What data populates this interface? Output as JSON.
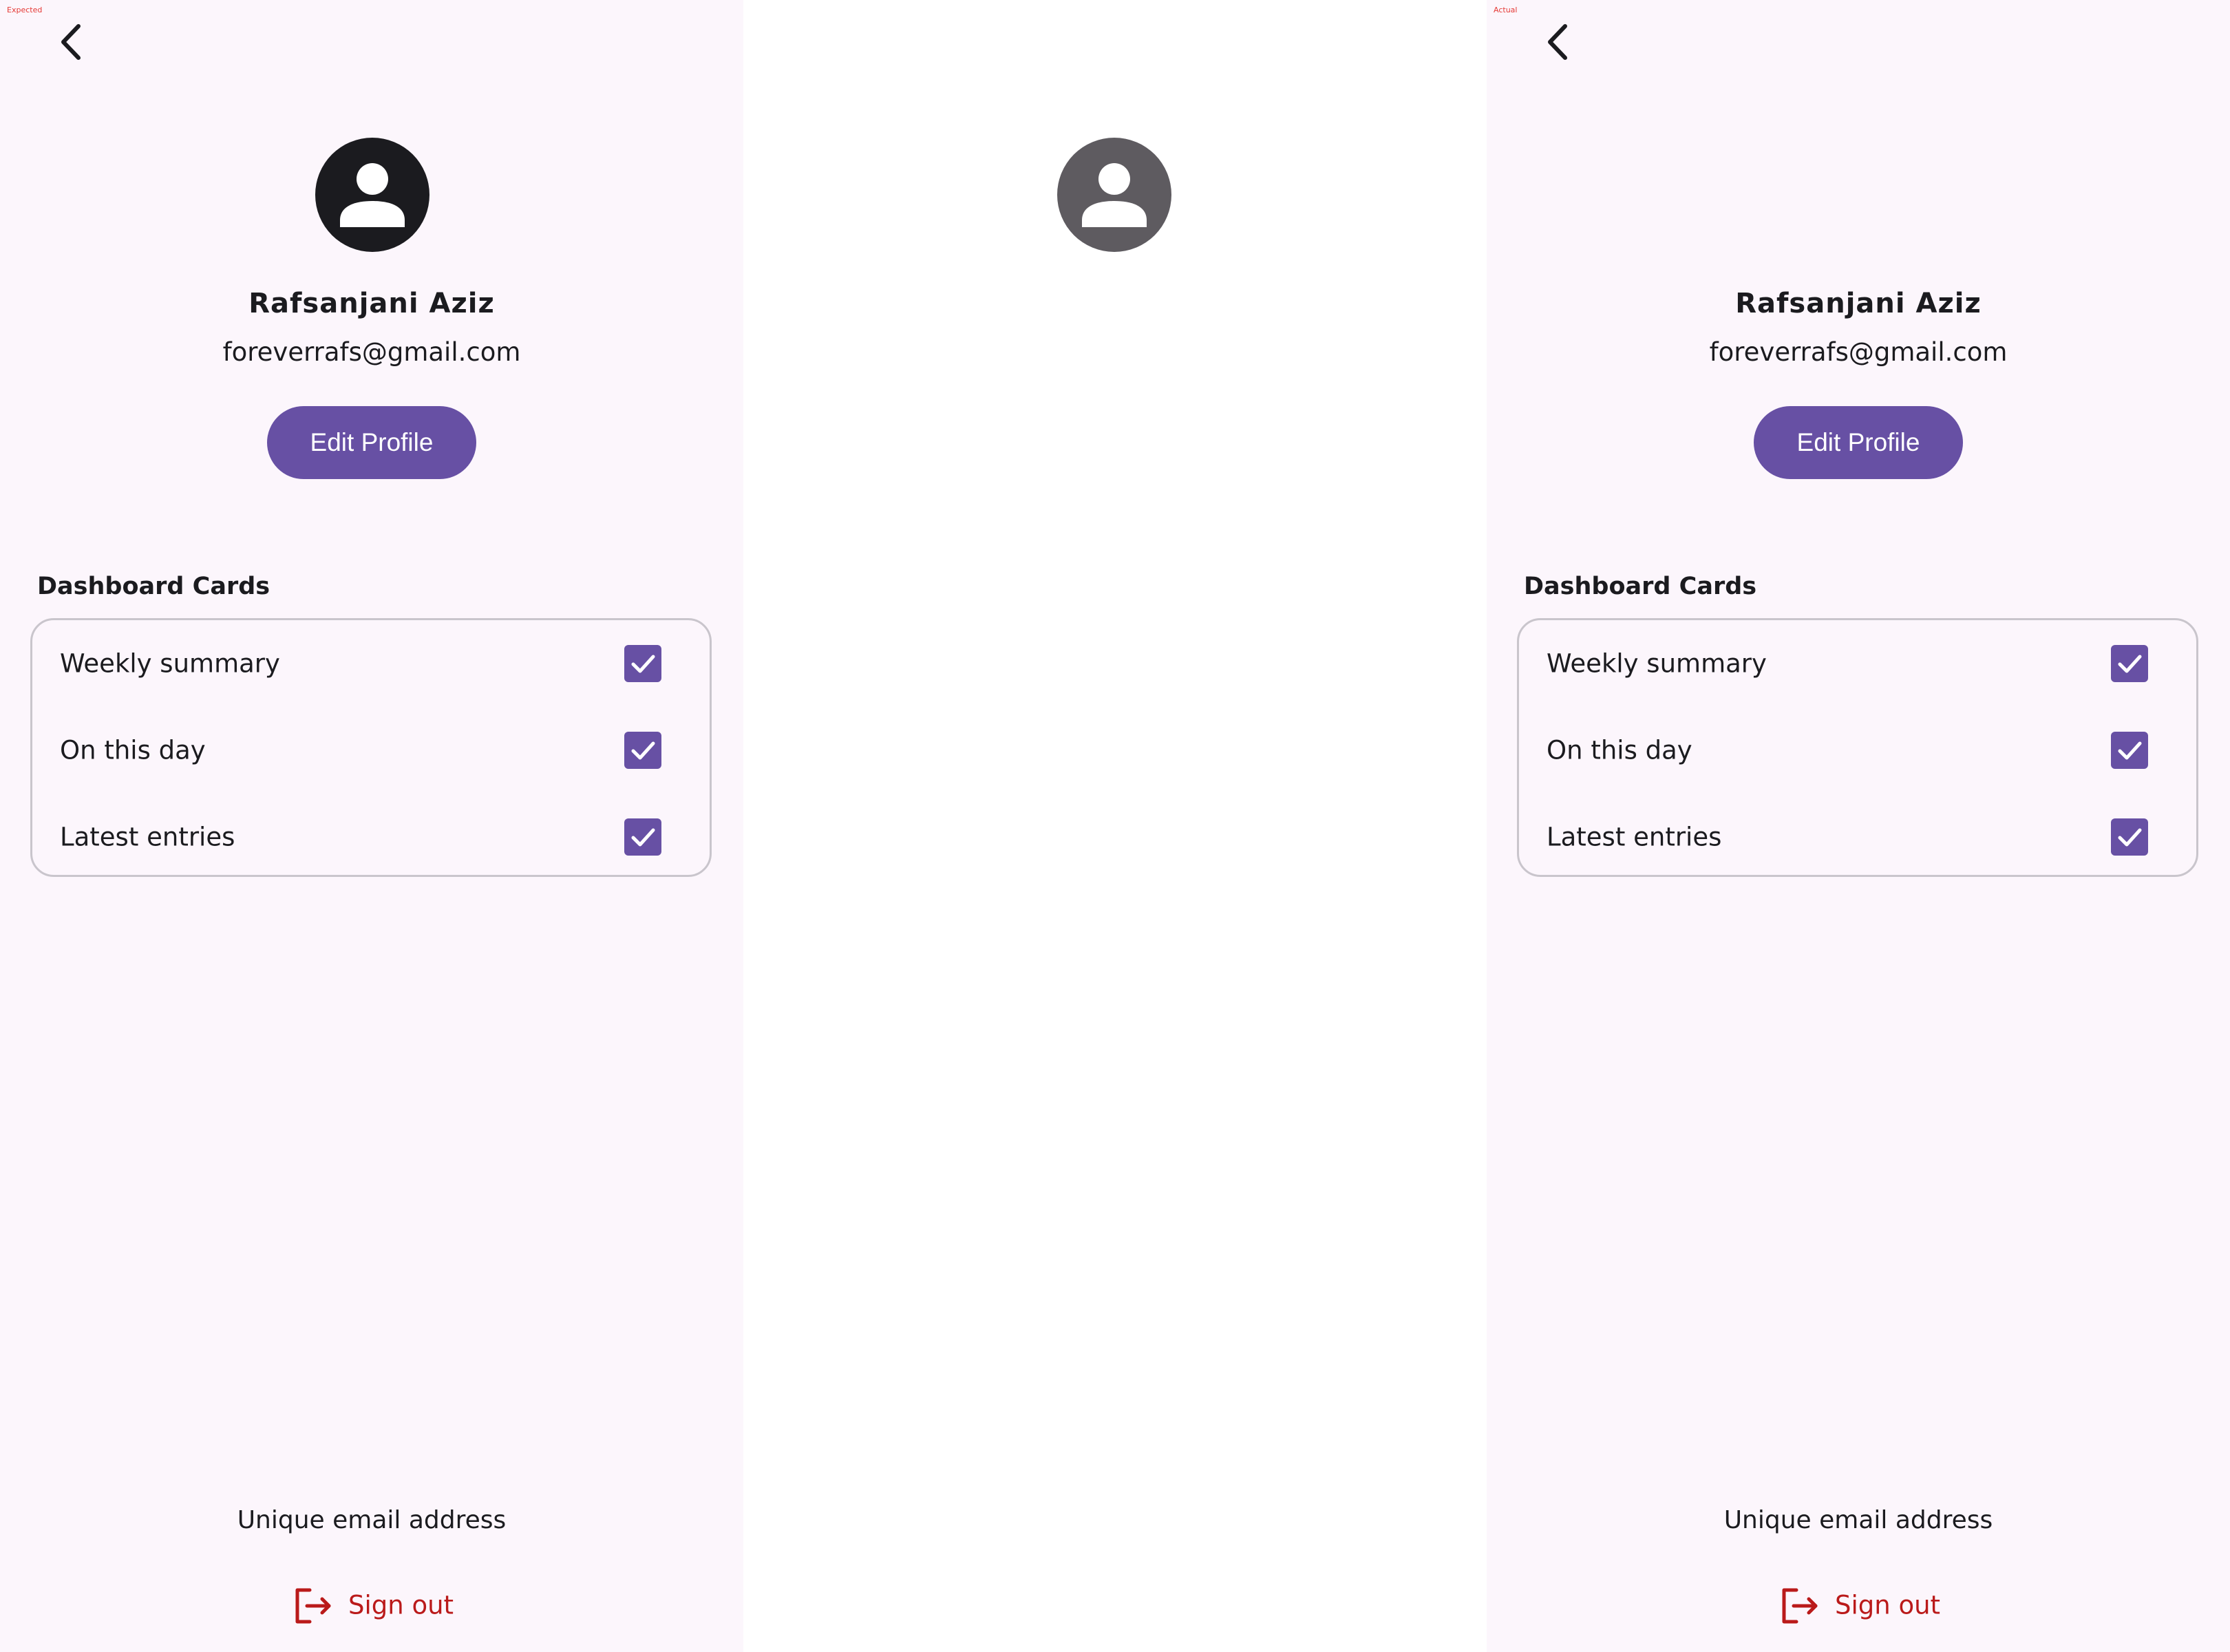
{
  "labels": {
    "expected": "Expected",
    "actual": "Actual"
  },
  "profile": {
    "name": "Rafsanjani Aziz",
    "email": "foreverrafs@gmail.com",
    "edit_button": "Edit Profile"
  },
  "dashboard": {
    "title": "Dashboard Cards",
    "items": [
      {
        "label": "Weekly summary",
        "checked": true
      },
      {
        "label": "On this day",
        "checked": true
      },
      {
        "label": "Latest entries",
        "checked": true
      }
    ]
  },
  "footer": {
    "unique_text": "Unique email address",
    "signout_label": "Sign out"
  },
  "colors": {
    "panel_bg": "#fcf6fc",
    "primary": "#6750a4",
    "error": "#ba1a1a",
    "avatar_expected": "#1b1b1f",
    "avatar_middle": "#5e5b60"
  },
  "icons": {
    "back": "arrow-back-icon",
    "avatar": "account-circle-icon",
    "check": "check-icon",
    "signout": "logout-icon"
  }
}
